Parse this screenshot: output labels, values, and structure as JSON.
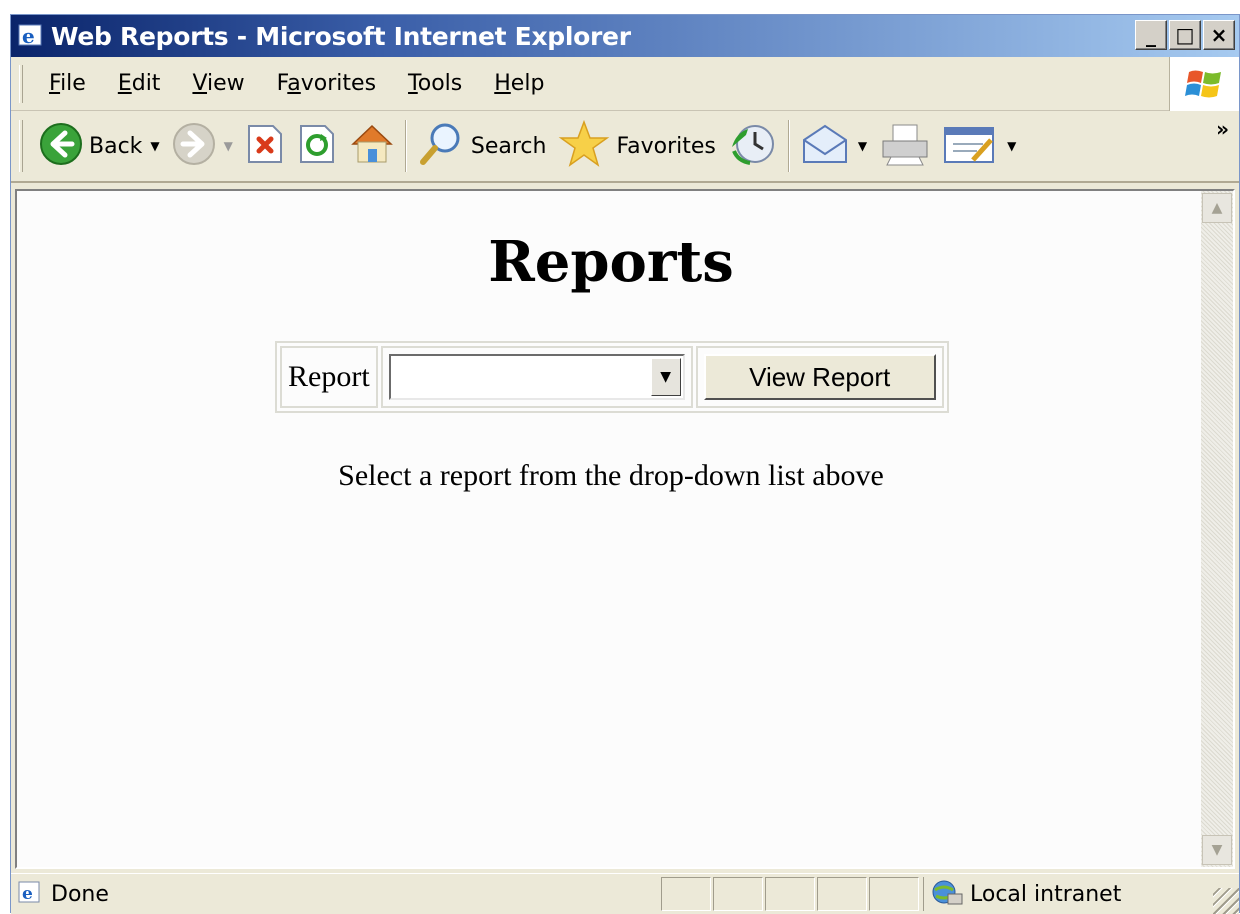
{
  "window": {
    "title": "Web Reports - Microsoft Internet Explorer",
    "controls": [
      "_",
      "□",
      "×"
    ]
  },
  "menu": {
    "items": [
      {
        "label": "File",
        "accel": "F",
        "rest": "ile"
      },
      {
        "label": "Edit",
        "accel": "E",
        "rest": "dit"
      },
      {
        "label": "View",
        "accel": "V",
        "rest": "iew"
      },
      {
        "label": "Favorites",
        "pre": "F",
        "accel": "a",
        "rest": "vorites"
      },
      {
        "label": "Tools",
        "accel": "T",
        "rest": "ools"
      },
      {
        "label": "Help",
        "accel": "H",
        "rest": "elp"
      }
    ]
  },
  "toolbar": {
    "back_label": "Back",
    "search_label": "Search",
    "favorites_label": "Favorites",
    "more": "»"
  },
  "page": {
    "title": "Reports",
    "report_label": "Report",
    "report_select_value": "",
    "view_button": "View Report",
    "hint": "Select a report from the drop-down list above"
  },
  "status": {
    "text": "Done",
    "zone": "Local intranet"
  },
  "colors": {
    "title_bar_start": "#0a246a",
    "title_bar_end": "#a6caf0",
    "chrome": "#ece9d8",
    "page_bg": "#fcfcfc"
  }
}
